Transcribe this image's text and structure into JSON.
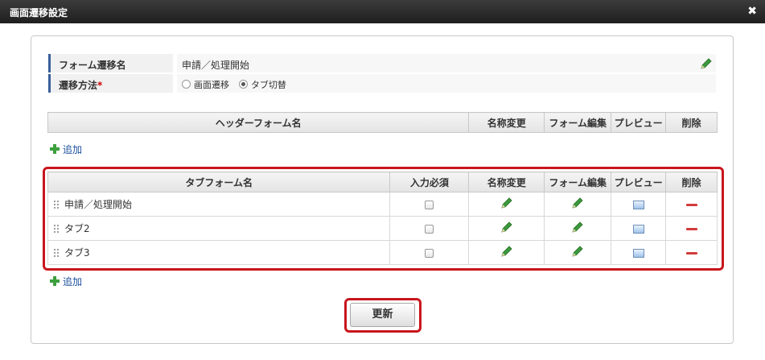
{
  "dialog": {
    "title": "画面遷移設定",
    "close_label": "✖"
  },
  "props": {
    "name_label": "フォーム遷移名",
    "name_value": "申請／処理開始",
    "method_label": "遷移方法",
    "method_required": "*",
    "method_options": [
      "画面遷移",
      "タブ切替"
    ],
    "method_selected": "タブ切替"
  },
  "header_table": {
    "columns": [
      "ヘッダーフォーム名",
      "名称変更",
      "フォーム編集",
      "プレビュー",
      "削除"
    ],
    "rows": []
  },
  "add_label": "追加",
  "tab_table": {
    "columns": [
      "タブフォーム名",
      "入力必須",
      "名称変更",
      "フォーム編集",
      "プレビュー",
      "削除"
    ],
    "rows": [
      {
        "name": "申請／処理開始",
        "required": false
      },
      {
        "name": "タブ2",
        "required": false
      },
      {
        "name": "タブ3",
        "required": false
      }
    ]
  },
  "update_button": "更新",
  "colors": {
    "accent": "#3a5f9a",
    "highlight": "#c8161d",
    "add": "#3ca03c",
    "delete": "#d23b3b",
    "edit": "#3c9a3c"
  },
  "icons": {
    "edit": "pencil-icon",
    "delete": "minus-icon",
    "preview": "preview-icon",
    "add": "plus-icon",
    "drag": "drag-handle-icon"
  }
}
